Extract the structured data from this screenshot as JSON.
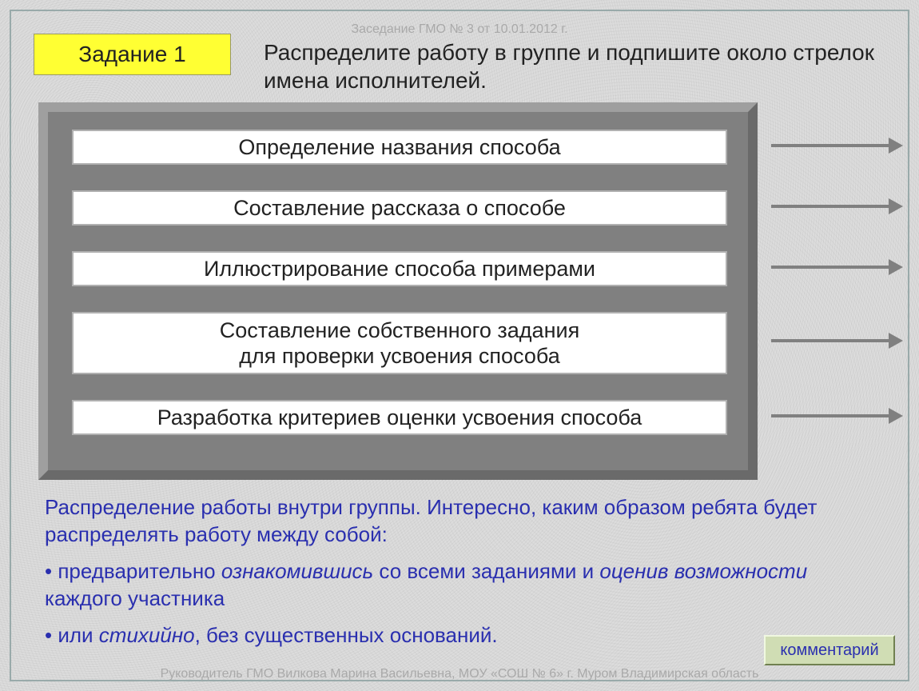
{
  "header_small": "Заседание ГМО № 3 от 10.01.2012 г.",
  "title_box": "Задание 1",
  "instruction": "Распределите работу в группе и подпишите около стрелок имена исполнителей.",
  "items": [
    "Определение названия способа",
    "Составление рассказа о способе",
    "Иллюстрирование способа примерами",
    "Составление собственного задания\nдля проверки усвоения способа",
    "Разработка критериев оценки усвоения способа"
  ],
  "commentary": {
    "line1": "Распределение работы внутри группы. Интересно, каким образом ребята будет распределять работу между собой:",
    "bullet1a": "•    предварительно ",
    "bullet1b": "ознакомившись",
    "bullet1c": " со всеми заданиями и ",
    "bullet1d": "оценив возможности",
    "bullet1e": " каждого участника",
    "bullet2a": "• или ",
    "bullet2b": "стихийно",
    "bullet2c": ", без существенных оснований."
  },
  "comment_button": "комментарий",
  "footer_small": "Руководитель ГМО Вилкова Марина Васильевна, МОУ «СОШ № 6» г. Муром Владимирская область"
}
